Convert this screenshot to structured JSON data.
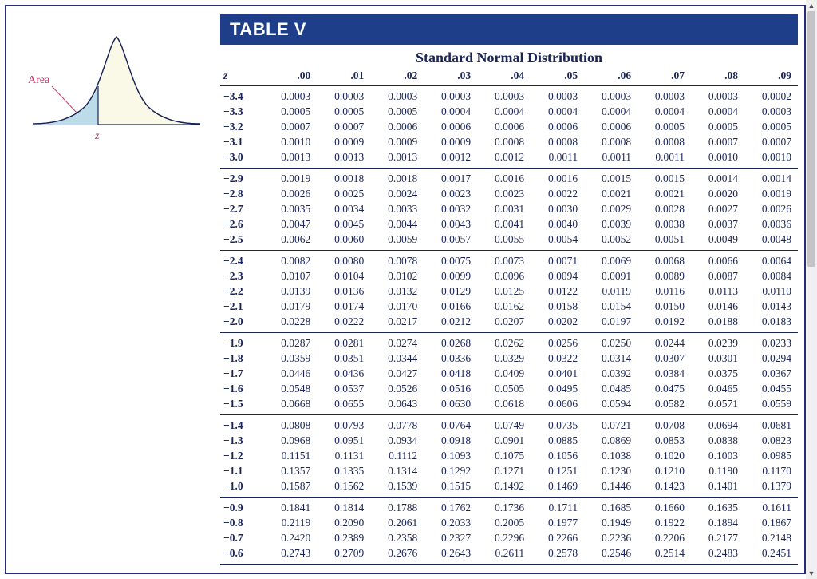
{
  "curve": {
    "area_label": "Area",
    "z_label": "z"
  },
  "table": {
    "title": "TABLE V",
    "subtitle": "Standard Normal Distribution",
    "z_header": "z",
    "col_headers": [
      ".00",
      ".01",
      ".02",
      ".03",
      ".04",
      ".05",
      ".06",
      ".07",
      ".08",
      ".09"
    ],
    "groups": [
      [
        {
          "z": "−3.4",
          "v": [
            "0.0003",
            "0.0003",
            "0.0003",
            "0.0003",
            "0.0003",
            "0.0003",
            "0.0003",
            "0.0003",
            "0.0003",
            "0.0002"
          ]
        },
        {
          "z": "−3.3",
          "v": [
            "0.0005",
            "0.0005",
            "0.0005",
            "0.0004",
            "0.0004",
            "0.0004",
            "0.0004",
            "0.0004",
            "0.0004",
            "0.0003"
          ]
        },
        {
          "z": "−3.2",
          "v": [
            "0.0007",
            "0.0007",
            "0.0006",
            "0.0006",
            "0.0006",
            "0.0006",
            "0.0006",
            "0.0005",
            "0.0005",
            "0.0005"
          ]
        },
        {
          "z": "−3.1",
          "v": [
            "0.0010",
            "0.0009",
            "0.0009",
            "0.0009",
            "0.0008",
            "0.0008",
            "0.0008",
            "0.0008",
            "0.0007",
            "0.0007"
          ]
        },
        {
          "z": "−3.0",
          "v": [
            "0.0013",
            "0.0013",
            "0.0013",
            "0.0012",
            "0.0012",
            "0.0011",
            "0.0011",
            "0.0011",
            "0.0010",
            "0.0010"
          ]
        }
      ],
      [
        {
          "z": "−2.9",
          "v": [
            "0.0019",
            "0.0018",
            "0.0018",
            "0.0017",
            "0.0016",
            "0.0016",
            "0.0015",
            "0.0015",
            "0.0014",
            "0.0014"
          ]
        },
        {
          "z": "−2.8",
          "v": [
            "0.0026",
            "0.0025",
            "0.0024",
            "0.0023",
            "0.0023",
            "0.0022",
            "0.0021",
            "0.0021",
            "0.0020",
            "0.0019"
          ]
        },
        {
          "z": "−2.7",
          "v": [
            "0.0035",
            "0.0034",
            "0.0033",
            "0.0032",
            "0.0031",
            "0.0030",
            "0.0029",
            "0.0028",
            "0.0027",
            "0.0026"
          ]
        },
        {
          "z": "−2.6",
          "v": [
            "0.0047",
            "0.0045",
            "0.0044",
            "0.0043",
            "0.0041",
            "0.0040",
            "0.0039",
            "0.0038",
            "0.0037",
            "0.0036"
          ]
        },
        {
          "z": "−2.5",
          "v": [
            "0.0062",
            "0.0060",
            "0.0059",
            "0.0057",
            "0.0055",
            "0.0054",
            "0.0052",
            "0.0051",
            "0.0049",
            "0.0048"
          ]
        }
      ],
      [
        {
          "z": "−2.4",
          "v": [
            "0.0082",
            "0.0080",
            "0.0078",
            "0.0075",
            "0.0073",
            "0.0071",
            "0.0069",
            "0.0068",
            "0.0066",
            "0.0064"
          ]
        },
        {
          "z": "−2.3",
          "v": [
            "0.0107",
            "0.0104",
            "0.0102",
            "0.0099",
            "0.0096",
            "0.0094",
            "0.0091",
            "0.0089",
            "0.0087",
            "0.0084"
          ]
        },
        {
          "z": "−2.2",
          "v": [
            "0.0139",
            "0.0136",
            "0.0132",
            "0.0129",
            "0.0125",
            "0.0122",
            "0.0119",
            "0.0116",
            "0.0113",
            "0.0110"
          ]
        },
        {
          "z": "−2.1",
          "v": [
            "0.0179",
            "0.0174",
            "0.0170",
            "0.0166",
            "0.0162",
            "0.0158",
            "0.0154",
            "0.0150",
            "0.0146",
            "0.0143"
          ]
        },
        {
          "z": "−2.0",
          "v": [
            "0.0228",
            "0.0222",
            "0.0217",
            "0.0212",
            "0.0207",
            "0.0202",
            "0.0197",
            "0.0192",
            "0.0188",
            "0.0183"
          ]
        }
      ],
      [
        {
          "z": "−1.9",
          "v": [
            "0.0287",
            "0.0281",
            "0.0274",
            "0.0268",
            "0.0262",
            "0.0256",
            "0.0250",
            "0.0244",
            "0.0239",
            "0.0233"
          ]
        },
        {
          "z": "−1.8",
          "v": [
            "0.0359",
            "0.0351",
            "0.0344",
            "0.0336",
            "0.0329",
            "0.0322",
            "0.0314",
            "0.0307",
            "0.0301",
            "0.0294"
          ]
        },
        {
          "z": "−1.7",
          "v": [
            "0.0446",
            "0.0436",
            "0.0427",
            "0.0418",
            "0.0409",
            "0.0401",
            "0.0392",
            "0.0384",
            "0.0375",
            "0.0367"
          ]
        },
        {
          "z": "−1.6",
          "v": [
            "0.0548",
            "0.0537",
            "0.0526",
            "0.0516",
            "0.0505",
            "0.0495",
            "0.0485",
            "0.0475",
            "0.0465",
            "0.0455"
          ]
        },
        {
          "z": "−1.5",
          "v": [
            "0.0668",
            "0.0655",
            "0.0643",
            "0.0630",
            "0.0618",
            "0.0606",
            "0.0594",
            "0.0582",
            "0.0571",
            "0.0559"
          ]
        }
      ],
      [
        {
          "z": "−1.4",
          "v": [
            "0.0808",
            "0.0793",
            "0.0778",
            "0.0764",
            "0.0749",
            "0.0735",
            "0.0721",
            "0.0708",
            "0.0694",
            "0.0681"
          ]
        },
        {
          "z": "−1.3",
          "v": [
            "0.0968",
            "0.0951",
            "0.0934",
            "0.0918",
            "0.0901",
            "0.0885",
            "0.0869",
            "0.0853",
            "0.0838",
            "0.0823"
          ]
        },
        {
          "z": "−1.2",
          "v": [
            "0.1151",
            "0.1131",
            "0.1112",
            "0.1093",
            "0.1075",
            "0.1056",
            "0.1038",
            "0.1020",
            "0.1003",
            "0.0985"
          ]
        },
        {
          "z": "−1.1",
          "v": [
            "0.1357",
            "0.1335",
            "0.1314",
            "0.1292",
            "0.1271",
            "0.1251",
            "0.1230",
            "0.1210",
            "0.1190",
            "0.1170"
          ]
        },
        {
          "z": "−1.0",
          "v": [
            "0.1587",
            "0.1562",
            "0.1539",
            "0.1515",
            "0.1492",
            "0.1469",
            "0.1446",
            "0.1423",
            "0.1401",
            "0.1379"
          ]
        }
      ],
      [
        {
          "z": "−0.9",
          "v": [
            "0.1841",
            "0.1814",
            "0.1788",
            "0.1762",
            "0.1736",
            "0.1711",
            "0.1685",
            "0.1660",
            "0.1635",
            "0.1611"
          ]
        },
        {
          "z": "−0.8",
          "v": [
            "0.2119",
            "0.2090",
            "0.2061",
            "0.2033",
            "0.2005",
            "0.1977",
            "0.1949",
            "0.1922",
            "0.1894",
            "0.1867"
          ]
        },
        {
          "z": "−0.7",
          "v": [
            "0.2420",
            "0.2389",
            "0.2358",
            "0.2327",
            "0.2296",
            "0.2266",
            "0.2236",
            "0.2206",
            "0.2177",
            "0.2148"
          ]
        },
        {
          "z": "−0.6",
          "v": [
            "0.2743",
            "0.2709",
            "0.2676",
            "0.2643",
            "0.2611",
            "0.2578",
            "0.2546",
            "0.2514",
            "0.2483",
            "0.2451"
          ]
        }
      ]
    ]
  }
}
